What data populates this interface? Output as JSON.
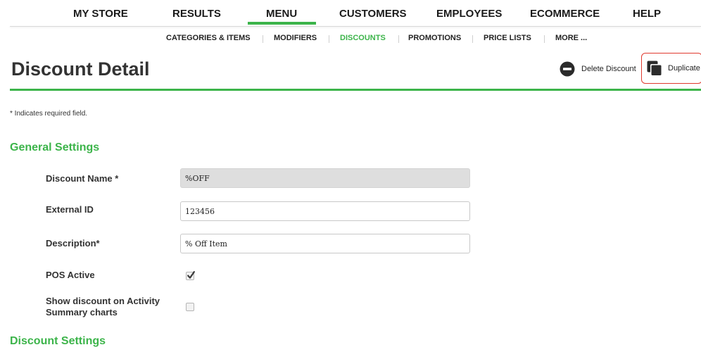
{
  "top_nav": {
    "items": [
      {
        "label": "MY STORE"
      },
      {
        "label": "RESULTS"
      },
      {
        "label": "MENU",
        "active": true
      },
      {
        "label": "CUSTOMERS"
      },
      {
        "label": "EMPLOYEES"
      },
      {
        "label": "ECOMMERCE"
      },
      {
        "label": "HELP"
      }
    ]
  },
  "sub_nav": {
    "items": [
      {
        "label": "CATEGORIES & ITEMS"
      },
      {
        "label": "MODIFIERS"
      },
      {
        "label": "DISCOUNTS",
        "active": true
      },
      {
        "label": "PROMOTIONS"
      },
      {
        "label": "PRICE LISTS"
      },
      {
        "label": "MORE ..."
      }
    ]
  },
  "header": {
    "title": "Discount Detail",
    "delete_label": "Delete Discount",
    "duplicate_label": "Duplicate",
    "delete_icon": "minus-circle-icon",
    "duplicate_icon": "copy-icon"
  },
  "required_note": "* Indicates required field.",
  "general_settings": {
    "title": "General Settings",
    "fields": {
      "discount_name": {
        "label": "Discount Name *",
        "value": "%OFF",
        "disabled": true
      },
      "external_id": {
        "label": "External ID",
        "value": "123456"
      },
      "description": {
        "label": "Description*",
        "value": "% Off Item"
      }
    },
    "pos_active": {
      "label": "POS Active",
      "checked": true
    },
    "show_on_charts": {
      "label": "Show discount on Activity Summary charts",
      "checked": false
    }
  },
  "discount_settings": {
    "title": "Discount Settings"
  },
  "colors": {
    "accent": "#3cb44a",
    "highlight_border": "#e03a2f",
    "text": "#333333",
    "disabled_field": "#dedede"
  }
}
